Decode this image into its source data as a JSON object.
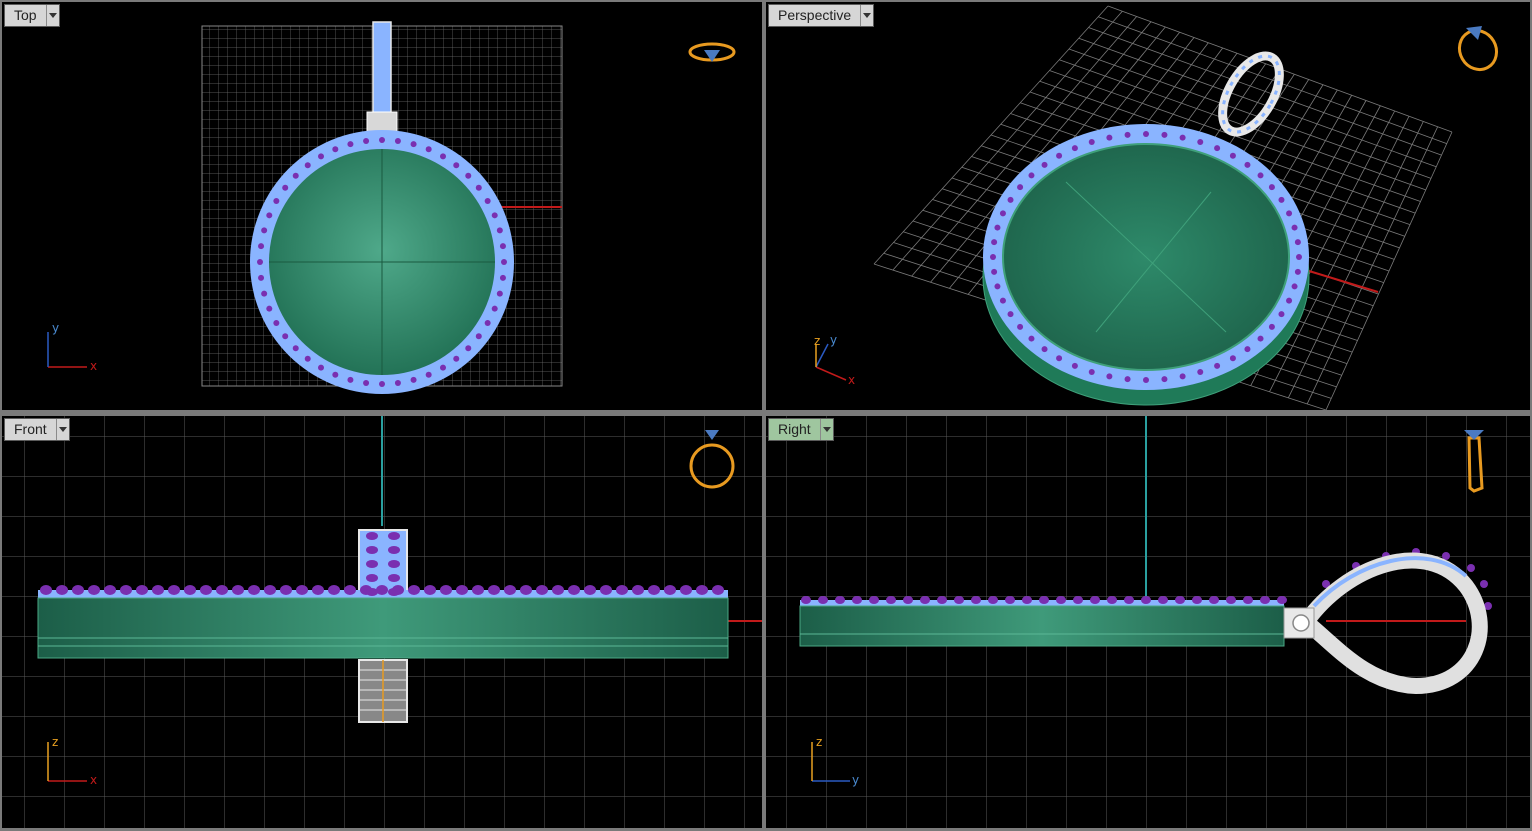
{
  "viewports": {
    "top": {
      "label": "Top",
      "axes": [
        "y",
        "x"
      ]
    },
    "perspective": {
      "label": "Perspective",
      "axes": [
        "z",
        "y",
        "x"
      ]
    },
    "front": {
      "label": "Front",
      "axes": [
        "z",
        "x"
      ]
    },
    "right": {
      "label": "Right",
      "axes": [
        "z",
        "y"
      ]
    }
  },
  "colors": {
    "background": "#000000",
    "grid": "#5a5a5a",
    "x_axis": "#c21a1a",
    "z_axis": "#2aa0a0",
    "pendant_fill": "#2e8a6a",
    "stone_ring": "#8ab4ff",
    "prongs": "#7a2fb0",
    "bail": "#e8e8e8",
    "ring_widget": "#e89a20",
    "active_tab": "#9fc69f"
  },
  "icons": [
    "ring-navigation-widget-icon",
    "viewport-menu-arrow-icon"
  ]
}
